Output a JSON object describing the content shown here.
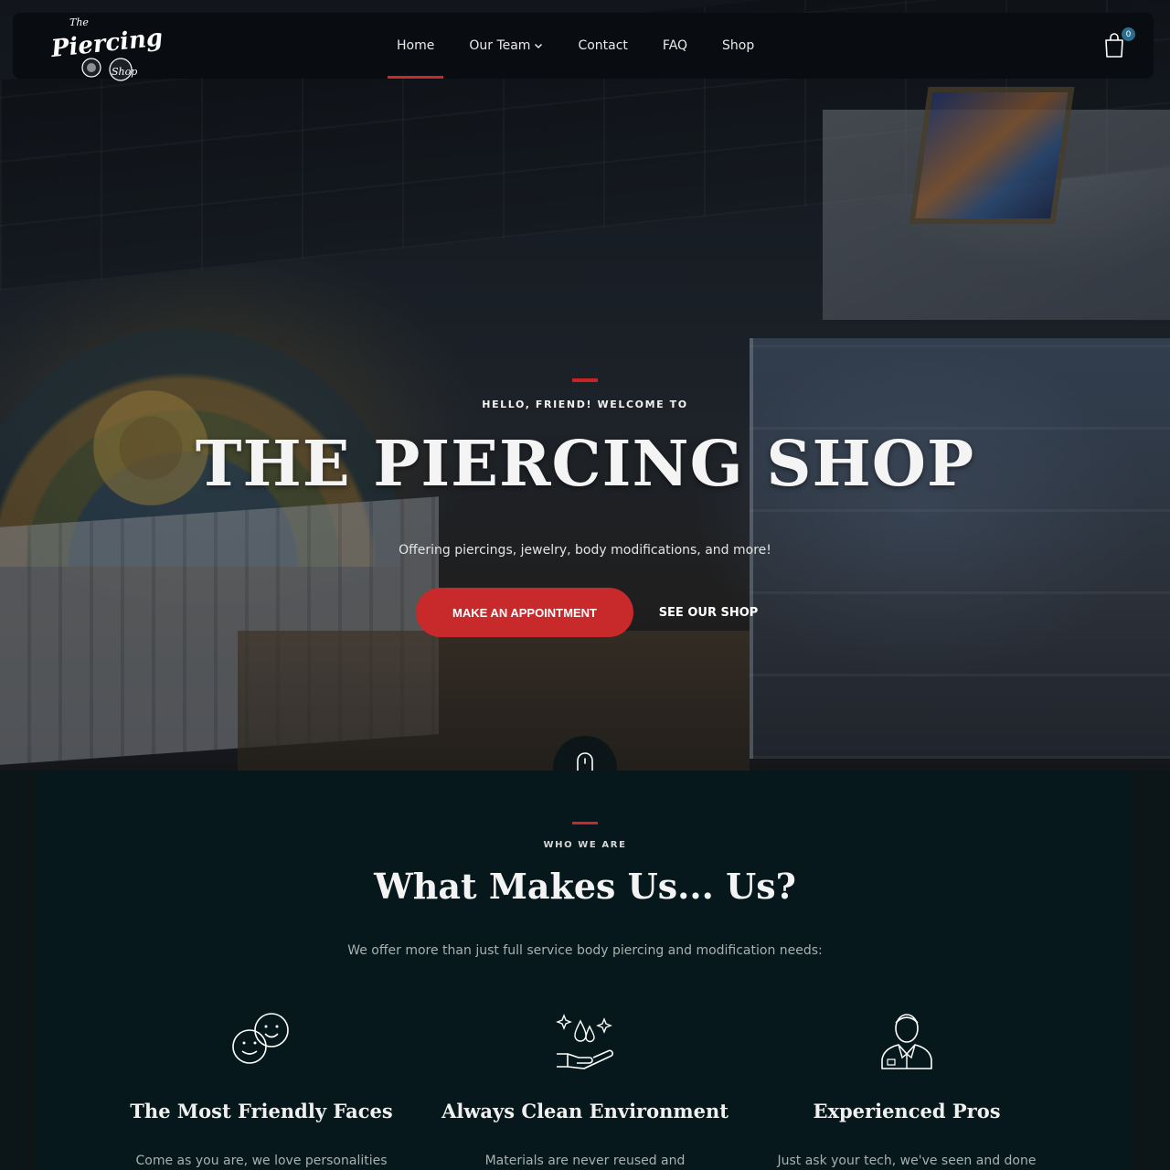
{
  "header": {
    "logo_text": "The Piercing Shop",
    "nav": [
      {
        "label": "Home"
      },
      {
        "label": "Our Team"
      },
      {
        "label": "Contact"
      },
      {
        "label": "FAQ"
      },
      {
        "label": "Shop"
      }
    ],
    "active_nav": "Home",
    "cart_count": "0",
    "cart_icon": "shopping-bag-icon"
  },
  "hero": {
    "eyebrow": "HELLO, FRIEND! WELCOME TO",
    "title": "THE PIERCING SHOP",
    "subtitle": "Offering piercings, jewelry, body modifications, and more!",
    "primary_button": "MAKE AN APPOINTMENT",
    "secondary_button": "SEE OUR SHOP",
    "scroll_icon": "mouse-scroll-icon"
  },
  "about": {
    "eyebrow": "WHO WE ARE",
    "title": "What Makes Us... Us?",
    "intro": "We offer more than just full service body piercing and modification needs:",
    "features": [
      {
        "icon": "smiley-faces-icon",
        "title": "The Most Friendly Faces",
        "text": "Come as you are, we love personalities"
      },
      {
        "icon": "clean-hand-icon",
        "title": "Always Clean Environment",
        "text": "Materials are never reused and"
      },
      {
        "icon": "professional-person-icon",
        "title": "Experienced Pros",
        "text": "Just ask your tech, we've seen and done"
      }
    ]
  },
  "colors": {
    "accent_red": "#c8292b",
    "header_bg": "#090d11",
    "section_bg": "#06181b",
    "cart_badge": "#2b6d8e"
  }
}
